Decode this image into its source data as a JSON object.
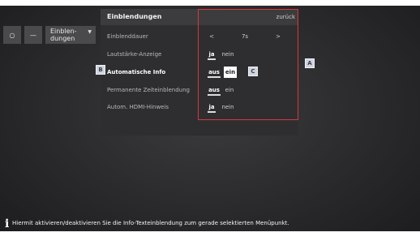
{
  "breadcrumb": {
    "items": [
      {
        "label": "○"
      },
      {
        "label": "—"
      },
      {
        "label": "Einblen-\ndungen"
      }
    ]
  },
  "panel": {
    "title": "Einblendungen",
    "back_label": "zurück",
    "rows": [
      {
        "label": "Einblenddauer",
        "options": [
          "<",
          "7s",
          ">"
        ]
      },
      {
        "label": "Lautstärke-Anzeige",
        "options": [
          "ja",
          "nein"
        ],
        "selected": "ja"
      },
      {
        "label": "Automatische Info",
        "options": [
          "aus",
          "ein"
        ],
        "selected": "ein",
        "active": true
      },
      {
        "label": "Permanente Zeiteinblendung",
        "options": [
          "aus",
          "ein"
        ],
        "selected": "aus"
      },
      {
        "label": "Autom. HDMI-Hinweis",
        "options": [
          "ja",
          "nein"
        ],
        "selected": "ja"
      }
    ]
  },
  "markers": {
    "a": "A",
    "b": "B",
    "c": "C"
  },
  "info": {
    "icon": "i",
    "text": "Hiermit aktivieren/deaktivieren Sie die Info-Texteinblendung zum gerade selektierten Menüpunkt."
  },
  "colors": {
    "highlight_box": "#d23a3a",
    "background": "#2a2a2c",
    "panel": "#2e2e30"
  }
}
